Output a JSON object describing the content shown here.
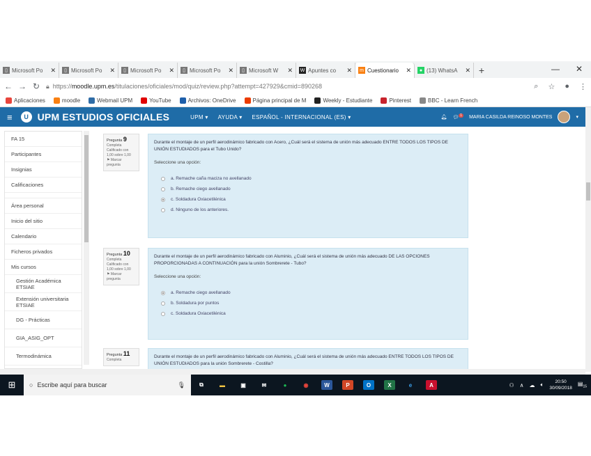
{
  "tabs": [
    {
      "label": "Microsoft Po",
      "fav_color": "#777",
      "fav_glyph": "▯"
    },
    {
      "label": "Microsoft Po",
      "fav_color": "#777",
      "fav_glyph": "▯"
    },
    {
      "label": "Microsoft Po",
      "fav_color": "#777",
      "fav_glyph": "▯"
    },
    {
      "label": "Microsoft Po",
      "fav_color": "#777",
      "fav_glyph": "▯"
    },
    {
      "label": "Microsoft W",
      "fav_color": "#777",
      "fav_glyph": "▯"
    },
    {
      "label": "Apuntes co",
      "fav_color": "#222",
      "fav_glyph": "W"
    },
    {
      "label": "Cuestionario",
      "fav_color": "#f98012",
      "fav_glyph": "m",
      "active": true
    },
    {
      "label": "(13) WhatsA",
      "fav_color": "#25d366",
      "fav_glyph": "●"
    }
  ],
  "address": {
    "url_prefix": "https://",
    "url_host": "moodle.upm.es",
    "url_path": "/titulaciones/oficiales/mod/quiz/review.php?attempt=427929&cmid=890268"
  },
  "bookmarks": [
    {
      "label": "Aplicaciones",
      "color": "#e8453c"
    },
    {
      "label": "moodle",
      "color": "#f98012"
    },
    {
      "label": "Webmail UPM",
      "color": "#2f6ca6"
    },
    {
      "label": "YouTube",
      "color": "#e00000"
    },
    {
      "label": "Archivos: OneDrive",
      "color": "#1e5faa"
    },
    {
      "label": "Página principal de M",
      "color": "#eb3c00"
    },
    {
      "label": "Weekly - Estudiante",
      "color": "#222"
    },
    {
      "label": "Pinterest",
      "color": "#c8232c"
    },
    {
      "label": "BBC - Learn French",
      "color": "#888"
    }
  ],
  "header": {
    "title": "UPM ESTUDIOS OFICIALES",
    "logo": "U",
    "menus": [
      "UPM ▾",
      "AYUDA ▾",
      "ESPAÑOL - INTERNACIONAL (ES) ▾"
    ],
    "user_name": "MARIA CASILDA REINOSO MONTES",
    "notifications": "1"
  },
  "drawer": {
    "items": [
      "FA 15",
      "Participantes",
      "Insignias",
      "Calificaciones",
      "",
      "Área personal",
      "Inicio del sitio",
      "Calendario",
      "Ficheros privados",
      "Mis cursos"
    ],
    "subitems": [
      "Gestión Académica ETSIAE",
      "Extensión universitaria ETSIAE",
      "DG - Prácticas",
      "GIA_ASIG_OPT",
      "Termodinámica"
    ]
  },
  "questions": [
    {
      "label": "Pregunta",
      "number": "9",
      "status": "Completa",
      "score": "Calificado con 1,00 sobre 1,00",
      "flag": "Marcar pregunta",
      "text": "Durante el montaje de un perfil aerodinámico fabricado con Acero, ¿Cuál será el sistema de unión más adecuado ENTRE TODOS LOS TIPOS DE UNIÓN ESTUDIADOS para el Tubo Unido?",
      "prompt": "Seleccione una opción:",
      "answers": [
        {
          "text": "a. Remache caña maciza no avellanado",
          "selected": false
        },
        {
          "text": "b. Remache ciego avellanado",
          "selected": false
        },
        {
          "text": "c. Soldadura Oxiacetilénica",
          "selected": true
        },
        {
          "text": "d. Ninguno de los anteriores.",
          "selected": false
        }
      ]
    },
    {
      "label": "Pregunta",
      "number": "10",
      "status": "Completa",
      "score": "Calificado con 1,00 sobre 1,00",
      "flag": "Marcar pregunta",
      "text": "Durante el montaje de un perfil aerodinámico fabricado con Aluminio, ¿Cuál será el sistema de unión más adecuado DE LAS OPCIONES PROPORCIONADAS A CONTINUACIÓN para la unión Sombrerete - Tubo?",
      "prompt": "Seleccione una opción:",
      "answers": [
        {
          "text": "a. Remache ciego avellanado",
          "selected": true
        },
        {
          "text": "b. Soldadura por puntos",
          "selected": false
        },
        {
          "text": "c. Soldadura Oxiacetilénica",
          "selected": false
        }
      ]
    },
    {
      "label": "Pregunta",
      "number": "11",
      "status": "Completa",
      "text": "Durante el montaje de un perfil aerodinámico fabricado con Aluminio, ¿Cuál será el sistema de unión más adecuado ENTRE TODOS LOS TIPOS DE UNIÓN ESTUDIADOS para la unión Sombrerete - Costilla?"
    }
  ],
  "taskbar": {
    "search_placeholder": "Escribe aquí para buscar",
    "time": "20:50",
    "date": "30/09/2018",
    "notif_count": "15",
    "apps": [
      {
        "name": "task-view",
        "glyph": "⧉",
        "color": "#fff",
        "bg": "transparent"
      },
      {
        "name": "file-explorer",
        "glyph": "▬",
        "color": "#f4c542",
        "bg": "transparent"
      },
      {
        "name": "store",
        "glyph": "▣",
        "color": "#fff",
        "bg": "transparent"
      },
      {
        "name": "mail",
        "glyph": "✉",
        "color": "#fff",
        "bg": "transparent"
      },
      {
        "name": "spotify",
        "glyph": "●",
        "color": "#1db954",
        "bg": "transparent"
      },
      {
        "name": "chrome",
        "glyph": "◉",
        "color": "#e8453c",
        "bg": "transparent"
      },
      {
        "name": "word",
        "glyph": "W",
        "color": "#fff",
        "bg": "#2b579a"
      },
      {
        "name": "powerpoint",
        "glyph": "P",
        "color": "#fff",
        "bg": "#d24726"
      },
      {
        "name": "outlook",
        "glyph": "O",
        "color": "#fff",
        "bg": "#0072c6"
      },
      {
        "name": "excel",
        "glyph": "X",
        "color": "#fff",
        "bg": "#217346"
      },
      {
        "name": "edge",
        "glyph": "e",
        "color": "#3b9fe8",
        "bg": "transparent"
      },
      {
        "name": "acrobat",
        "glyph": "A",
        "color": "#fff",
        "bg": "#c8102e"
      }
    ]
  }
}
